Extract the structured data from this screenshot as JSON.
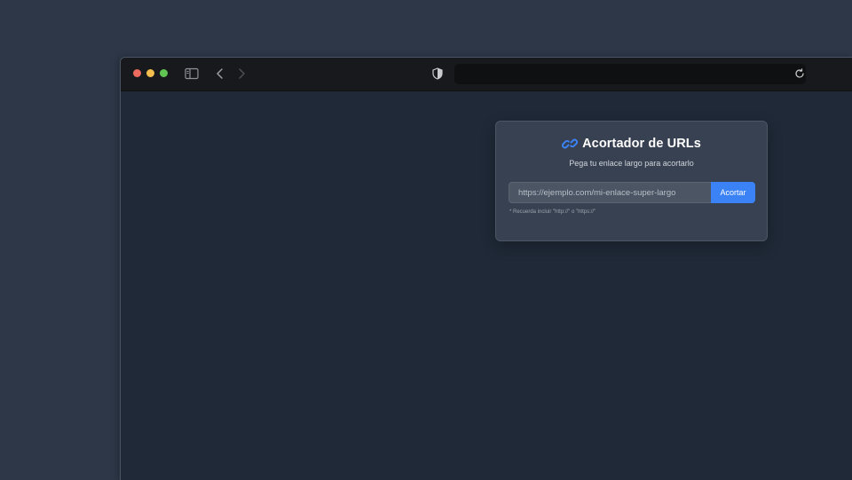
{
  "browser": {
    "icons": {
      "sidebar": "sidebar-icon",
      "back": "chevron-left-icon",
      "forward": "chevron-right-icon",
      "shield": "shield-icon",
      "reload": "reload-icon"
    },
    "address_value": ""
  },
  "card": {
    "icon": "link-icon",
    "title": "Acortador de URLs",
    "subtitle": "Pega tu enlace largo para acortarlo",
    "input_placeholder": "https://ejemplo.com/mi-enlace-super-largo",
    "input_value": "",
    "button_label": "Acortar",
    "hint": "* Recuerda incluir \"http://\" o \"https://\""
  },
  "colors": {
    "accent": "#3b82f6",
    "background": "#1f2937",
    "card": "#374151"
  }
}
